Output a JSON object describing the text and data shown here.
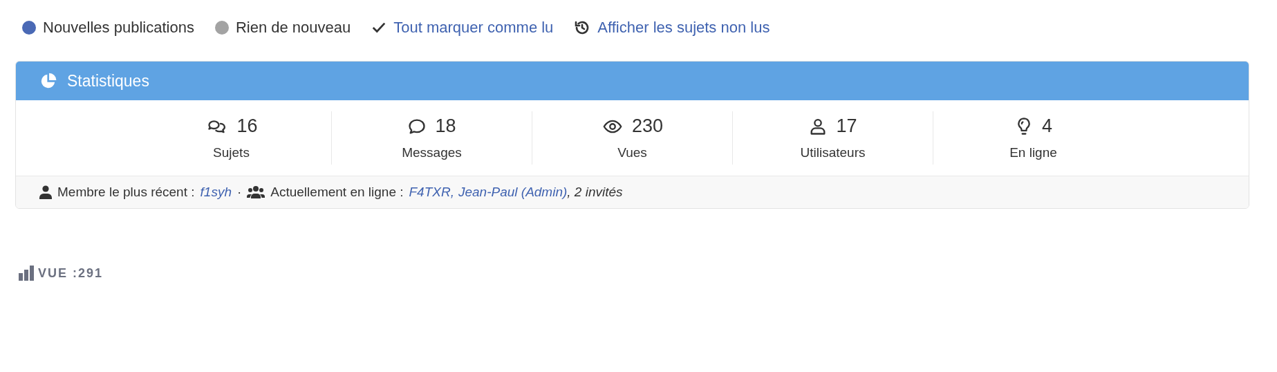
{
  "legend": [
    {
      "kind": "dot",
      "label": "Nouvelles publications",
      "color": "#4a69b5"
    },
    {
      "kind": "dot",
      "label": "Rien de nouveau",
      "color": "#a3a3a3"
    },
    {
      "kind": "check",
      "label": "Tout marquer comme lu"
    },
    {
      "kind": "history",
      "label": "Afficher les sujets non lus"
    }
  ],
  "panel": {
    "title": "Statistiques",
    "stats": [
      {
        "kind": "topics",
        "value": "16",
        "label": "Sujets"
      },
      {
        "kind": "messages",
        "value": "18",
        "label": "Messages"
      },
      {
        "kind": "views",
        "value": "230",
        "label": "Vues"
      },
      {
        "kind": "users",
        "value": "17",
        "label": "Utilisateurs"
      },
      {
        "kind": "online",
        "value": "4",
        "label": "En ligne"
      }
    ],
    "footer": {
      "newest_label": "Membre le plus récent :",
      "newest_member": "f1syh",
      "separator": "·",
      "online_label": "Actuellement en ligne :",
      "online_users": [
        "F4TXR,",
        "Jean-Paul (Admin)"
      ],
      "guests": ", 2 invités"
    }
  },
  "views_counter": "VUE :291"
}
